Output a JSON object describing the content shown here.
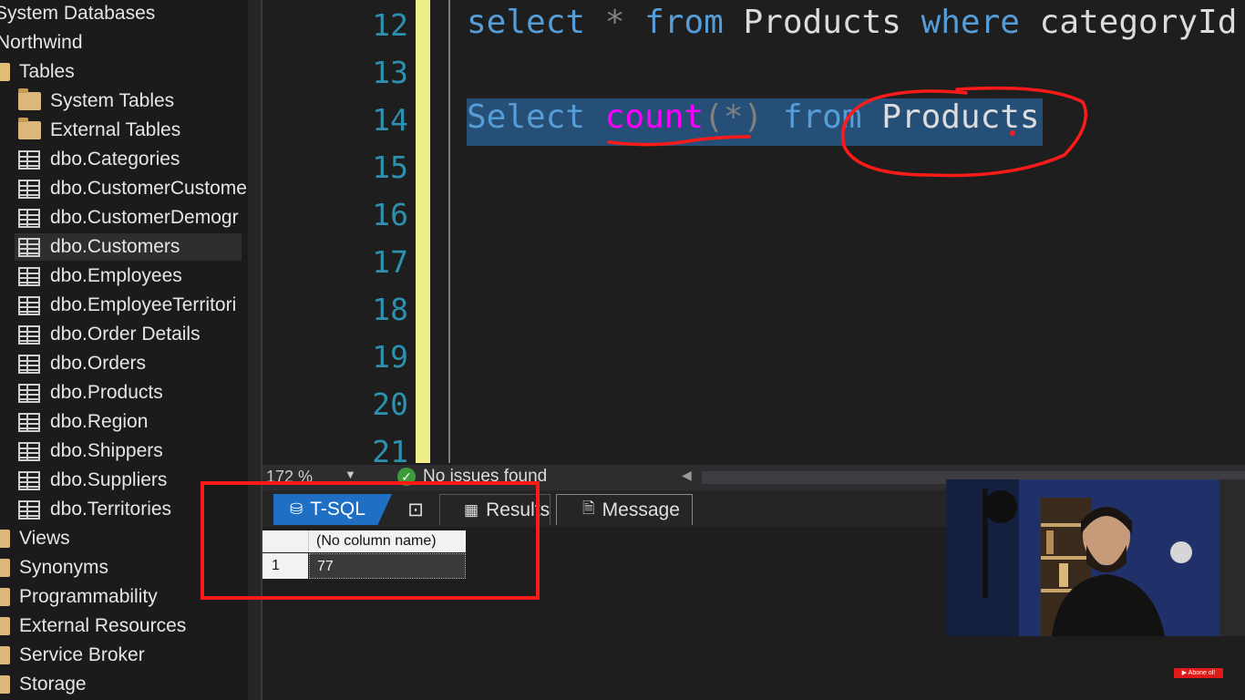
{
  "explorer": {
    "items": [
      {
        "label": "System Databases",
        "icon": "none"
      },
      {
        "label": "Northwind",
        "icon": "none"
      },
      {
        "label": "Tables",
        "icon": "folder-open-icon"
      },
      {
        "label": "System Tables",
        "icon": "folder-icon"
      },
      {
        "label": "External Tables",
        "icon": "folder-icon"
      },
      {
        "label": "dbo.Categories",
        "icon": "table-icon"
      },
      {
        "label": "dbo.CustomerCustome",
        "icon": "table-icon"
      },
      {
        "label": "dbo.CustomerDemogr",
        "icon": "table-icon"
      },
      {
        "label": "dbo.Customers",
        "icon": "table-icon",
        "selected": true
      },
      {
        "label": "dbo.Employees",
        "icon": "table-icon"
      },
      {
        "label": "dbo.EmployeeTerritori",
        "icon": "table-icon"
      },
      {
        "label": "dbo.Order Details",
        "icon": "table-icon"
      },
      {
        "label": "dbo.Orders",
        "icon": "table-icon"
      },
      {
        "label": "dbo.Products",
        "icon": "table-icon"
      },
      {
        "label": "dbo.Region",
        "icon": "table-icon"
      },
      {
        "label": "dbo.Shippers",
        "icon": "table-icon"
      },
      {
        "label": "dbo.Suppliers",
        "icon": "table-icon"
      },
      {
        "label": "dbo.Territories",
        "icon": "table-icon"
      },
      {
        "label": "Views",
        "icon": "folder-icon"
      },
      {
        "label": "Synonyms",
        "icon": "folder-icon"
      },
      {
        "label": "Programmability",
        "icon": "folder-icon"
      },
      {
        "label": "External Resources",
        "icon": "folder-icon"
      },
      {
        "label": "Service Broker",
        "icon": "folder-icon"
      },
      {
        "label": "Storage",
        "icon": "folder-icon"
      }
    ]
  },
  "editor": {
    "line_numbers": [
      "12",
      "13",
      "14",
      "15",
      "16",
      "17",
      "18",
      "19",
      "20",
      "21"
    ],
    "line12": {
      "kw1": "select",
      "star": "*",
      "kw2": "from",
      "table": "Products",
      "kw3": "where",
      "rest": "categoryId"
    },
    "line14": {
      "kw1": "Select",
      "fn": "count",
      "args": "(*)",
      "kw2": "from",
      "table": "Products"
    }
  },
  "status": {
    "zoom": "172 %",
    "issues": "No issues found"
  },
  "tabs": {
    "tsql": "T-SQL",
    "results": "Results",
    "message": "Message"
  },
  "results_grid": {
    "columns": [
      "(No column name)"
    ],
    "rows": [
      {
        "row_number": "1",
        "values": [
          "77"
        ]
      }
    ]
  },
  "overlay": {
    "subscribe_label": "Abone ol!"
  },
  "colors": {
    "keyword": "#569cd6",
    "function": "#ff00ff",
    "line_number": "#2b91af",
    "selection": "#264f78",
    "annotation": "#ff1a1a",
    "active_tab": "#1f6fc4"
  }
}
